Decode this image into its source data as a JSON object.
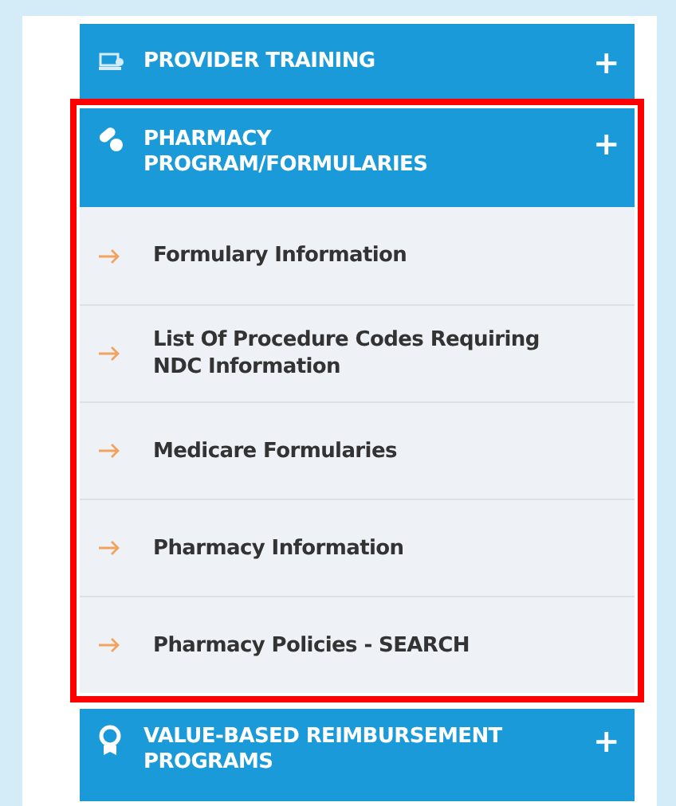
{
  "menu": [
    {
      "title": "PROVIDER TRAINING",
      "toggle": "+",
      "expanded": false,
      "highlighted": false
    },
    {
      "title": "PHARMACY PROGRAM/FORMULARIES",
      "toggle": "+",
      "expanded": true,
      "highlighted": true,
      "items": [
        {
          "label": "Formulary Information"
        },
        {
          "label": "List Of Procedure Codes Requiring NDC Information"
        },
        {
          "label": "Medicare Formularies"
        },
        {
          "label": "Pharmacy Information"
        },
        {
          "label": "Pharmacy Policies - SEARCH"
        }
      ]
    },
    {
      "title": "VALUE-BASED REIMBURSEMENT PROGRAMS",
      "toggle": "+",
      "expanded": false,
      "highlighted": false
    }
  ]
}
